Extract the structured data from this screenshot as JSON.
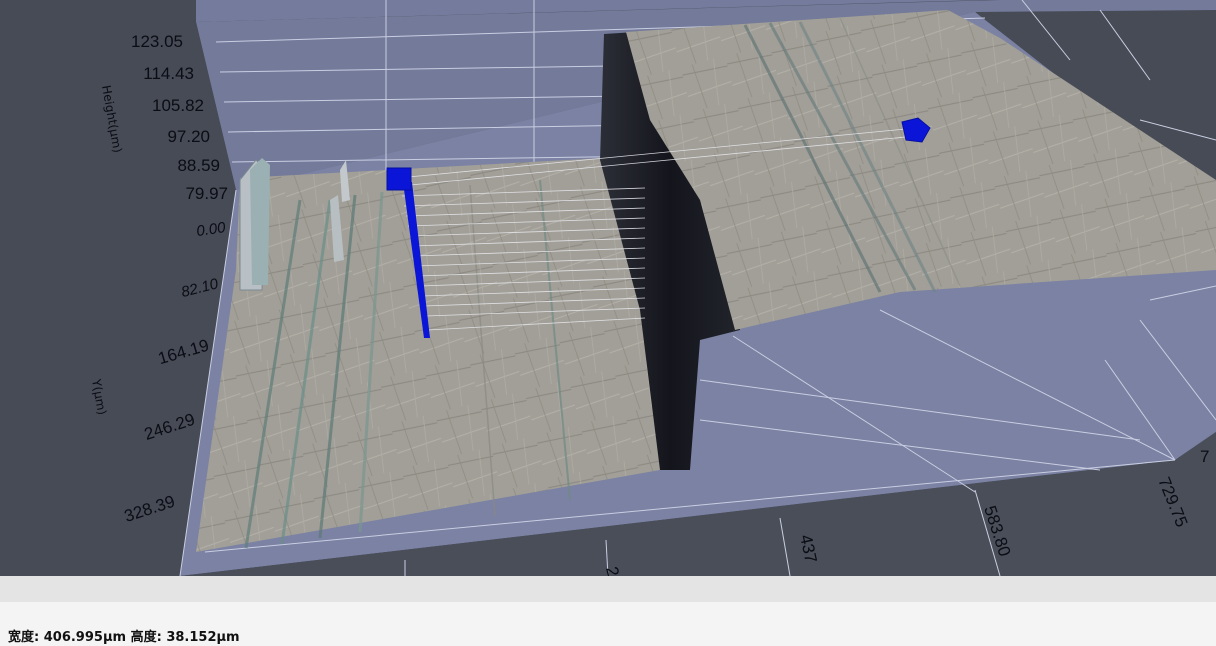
{
  "viewer": {
    "height_axis": {
      "title": "Height(μm)",
      "ticks": [
        "123.05",
        "114.43",
        "105.82",
        "97.20",
        "88.59",
        "79.97"
      ]
    },
    "y_axis": {
      "title": "Y(μm)",
      "ticks": [
        "0.00",
        "82.10",
        "164.19",
        "246.29",
        "328.39"
      ]
    },
    "x_axis": {
      "ticks": [
        "2",
        "437",
        "583.80",
        "729.75",
        "7"
      ]
    },
    "colors": {
      "background": "#474b56",
      "grid_plane": "#7a81a2",
      "grid_line": "#c7cde0",
      "surface": "#9d9d95",
      "step_shadow": "#191a22",
      "marker": "#0a15d8"
    }
  },
  "status": {
    "width_label": "宽度:",
    "width_value": "406.995μm",
    "height_label": "高度:",
    "height_value": "38.152μm"
  }
}
